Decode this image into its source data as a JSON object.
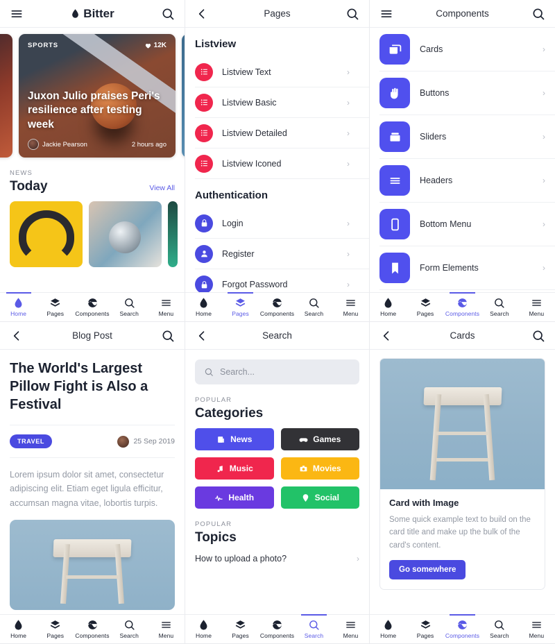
{
  "panels": {
    "home": {
      "header": {
        "brand": "Bitter",
        "menu_icon": "hamburger-icon",
        "search_icon": "search-icon"
      },
      "hero": {
        "category": "SPORTS",
        "likes": "12K",
        "title": "Juxon Julio praises Peri's resilience after testing week",
        "author": "Jackie Pearson",
        "time": "2 hours ago"
      },
      "section": {
        "kicker": "NEWS",
        "title": "Today",
        "link": "View All"
      },
      "nav": [
        {
          "label": "Home",
          "icon": "drop-icon",
          "active": true
        },
        {
          "label": "Pages",
          "icon": "layers-icon",
          "active": false
        },
        {
          "label": "Components",
          "icon": "circle-wave-icon",
          "active": false
        },
        {
          "label": "Search",
          "icon": "search-icon",
          "active": false
        },
        {
          "label": "Menu",
          "icon": "hamburger-icon",
          "active": false
        }
      ]
    },
    "pages": {
      "header": {
        "title": "Pages",
        "back_icon": "chevron-left-icon",
        "search_icon": "search-icon"
      },
      "groups": [
        {
          "title": "Listview",
          "items": [
            {
              "label": "Listview Text",
              "icon": "list-icon"
            },
            {
              "label": "Listview Basic",
              "icon": "list-icon"
            },
            {
              "label": "Listview Detailed",
              "icon": "list-icon"
            },
            {
              "label": "Listview Iconed",
              "icon": "list-icon"
            }
          ]
        },
        {
          "title": "Authentication",
          "items": [
            {
              "label": "Login",
              "icon": "lock-icon"
            },
            {
              "label": "Register",
              "icon": "user-icon"
            },
            {
              "label": "Forgot Password",
              "icon": "lock-icon"
            }
          ]
        }
      ],
      "nav": [
        {
          "label": "Home",
          "icon": "drop-icon",
          "active": false
        },
        {
          "label": "Pages",
          "icon": "layers-icon",
          "active": true
        },
        {
          "label": "Components",
          "icon": "circle-wave-icon",
          "active": false
        },
        {
          "label": "Search",
          "icon": "search-icon",
          "active": false
        },
        {
          "label": "Menu",
          "icon": "hamburger-icon",
          "active": false
        }
      ]
    },
    "components": {
      "header": {
        "title": "Components",
        "menu_icon": "hamburger-icon",
        "search_icon": "search-icon"
      },
      "items": [
        {
          "label": "Cards",
          "icon": "cards-icon"
        },
        {
          "label": "Buttons",
          "icon": "hand-icon"
        },
        {
          "label": "Sliders",
          "icon": "box-icon"
        },
        {
          "label": "Headers",
          "icon": "lines-icon"
        },
        {
          "label": "Bottom Menu",
          "icon": "phone-icon"
        },
        {
          "label": "Form Elements",
          "icon": "bookmark-icon"
        }
      ],
      "nav": [
        {
          "label": "Home",
          "icon": "drop-icon",
          "active": false
        },
        {
          "label": "Pages",
          "icon": "layers-icon",
          "active": false
        },
        {
          "label": "Components",
          "icon": "circle-wave-icon",
          "active": true
        },
        {
          "label": "Search",
          "icon": "search-icon",
          "active": false
        },
        {
          "label": "Menu",
          "icon": "hamburger-icon",
          "active": false
        }
      ]
    },
    "blogpost": {
      "header": {
        "title": "Blog Post",
        "back_icon": "chevron-left-icon",
        "search_icon": "search-icon"
      },
      "title": "The World's Largest Pillow Fight is Also a Festival",
      "tag": "TRAVEL",
      "date": "25 Sep 2019",
      "body": "Lorem ipsum dolor sit amet, consectetur adipiscing elit. Etiam eget ligula efficitur, accumsan magna vitae, lobortis turpis.",
      "nav": [
        {
          "label": "Home",
          "icon": "drop-icon",
          "active": false
        },
        {
          "label": "Pages",
          "icon": "layers-icon",
          "active": false
        },
        {
          "label": "Components",
          "icon": "circle-wave-icon",
          "active": false
        },
        {
          "label": "Search",
          "icon": "search-icon",
          "active": false
        },
        {
          "label": "Menu",
          "icon": "hamburger-icon",
          "active": false
        }
      ]
    },
    "search": {
      "header": {
        "title": "Search",
        "back_icon": "chevron-left-icon"
      },
      "search_placeholder": "Search...",
      "categories_kicker": "POPULAR",
      "categories_title": "Categories",
      "categories": [
        {
          "label": "News",
          "icon": "newspaper-icon",
          "color": "#4f4fea"
        },
        {
          "label": "Games",
          "icon": "gamepad-icon",
          "color": "#323236"
        },
        {
          "label": "Music",
          "icon": "music-icon",
          "color": "#f0264d"
        },
        {
          "label": "Movies",
          "icon": "camera-icon",
          "color": "#fbb713"
        },
        {
          "label": "Health",
          "icon": "pulse-icon",
          "color": "#6a3ae0"
        },
        {
          "label": "Social",
          "icon": "pin-icon",
          "color": "#22c268"
        }
      ],
      "topics_kicker": "POPULAR",
      "topics_title": "Topics",
      "topics": [
        {
          "label": "How to upload a photo?"
        }
      ],
      "nav": [
        {
          "label": "Home",
          "icon": "drop-icon",
          "active": false
        },
        {
          "label": "Pages",
          "icon": "layers-icon",
          "active": false
        },
        {
          "label": "Components",
          "icon": "circle-wave-icon",
          "active": false
        },
        {
          "label": "Search",
          "icon": "search-icon",
          "active": true
        },
        {
          "label": "Menu",
          "icon": "hamburger-icon",
          "active": false
        }
      ]
    },
    "cards": {
      "header": {
        "title": "Cards",
        "back_icon": "chevron-left-icon",
        "search_icon": "search-icon"
      },
      "card": {
        "title": "Card with Image",
        "text": "Some quick example text to build on the card title and make up the bulk of the card's content.",
        "button": "Go somewhere"
      },
      "nav": [
        {
          "label": "Home",
          "icon": "drop-icon",
          "active": false
        },
        {
          "label": "Pages",
          "icon": "layers-icon",
          "active": false
        },
        {
          "label": "Components",
          "icon": "circle-wave-icon",
          "active": true
        },
        {
          "label": "Search",
          "icon": "search-icon",
          "active": false
        },
        {
          "label": "Menu",
          "icon": "hamburger-icon",
          "active": false
        }
      ]
    }
  },
  "colors": {
    "accent": "#5a5ae6",
    "indigo": "#4a4ae0",
    "red": "#f0264d",
    "dark": "#1c2230",
    "muted": "#9399a4"
  }
}
